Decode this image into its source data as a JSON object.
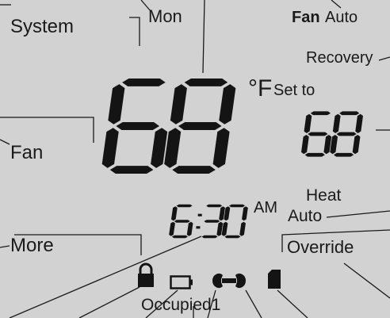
{
  "labels": {
    "system": "System",
    "day": "Mon",
    "fan_word": "Fan",
    "fan_mode": "Auto",
    "recovery": "Recovery",
    "fan": "Fan",
    "unit": "°F",
    "set_to": "Set to",
    "am": "AM",
    "heat": "Heat",
    "auto": "Auto",
    "more": "More",
    "override": "Override",
    "occupied": "Occupied1"
  },
  "readouts": {
    "room_temperature": "68",
    "set_temperature": "68",
    "time": "6:30"
  },
  "icons": [
    "lock-icon",
    "battery-icon",
    "wrench-icon",
    "filter-icon"
  ],
  "colors": {
    "panel": "#d2d2d2",
    "segment": "#141414",
    "text": "#1a1a1a",
    "leader": "#1a1a1a"
  }
}
